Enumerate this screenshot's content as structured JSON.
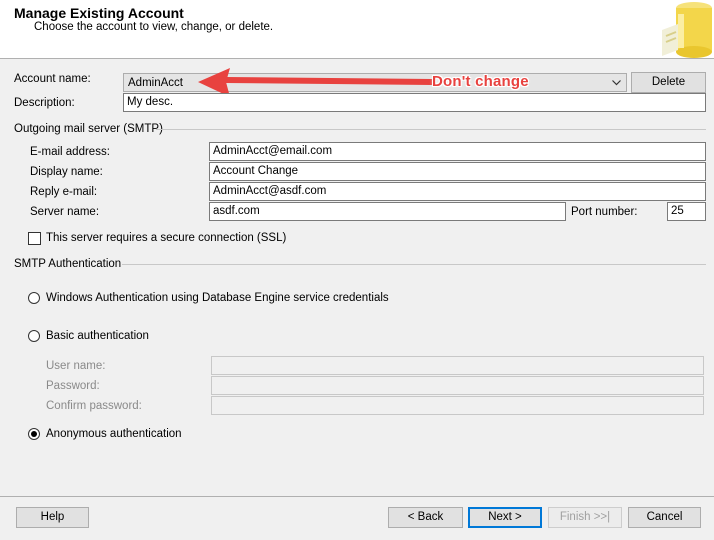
{
  "header": {
    "title": "Manage Existing Account",
    "subtitle": "Choose the account to view, change, or delete."
  },
  "account": {
    "name_label": "Account name:",
    "name_value": "AdminAcct",
    "delete_label": "Delete",
    "description_label": "Description:",
    "description_value": "My desc."
  },
  "annotation": {
    "text": "Don't change",
    "color": "#e8423f"
  },
  "smtp": {
    "section_label": "Outgoing mail server (SMTP)",
    "email_label": "E-mail address:",
    "email_value": "AdminAcct@email.com",
    "display_label": "Display name:",
    "display_value": "Account Change",
    "reply_label": "Reply e-mail:",
    "reply_value": "AdminAcct@asdf.com",
    "server_label": "Server name:",
    "server_value": "asdf.com",
    "port_label": "Port number:",
    "port_value": "25",
    "ssl_label": "This server requires a secure connection (SSL)",
    "ssl_checked": false
  },
  "auth": {
    "section_label": "SMTP Authentication",
    "windows_label": "Windows Authentication using Database Engine service credentials",
    "basic_label": "Basic authentication",
    "username_label": "User name:",
    "password_label": "Password:",
    "confirm_label": "Confirm password:",
    "anonymous_label": "Anonymous authentication",
    "selected": "anonymous"
  },
  "footer": {
    "help": "Help",
    "back": "< Back",
    "next": "Next >",
    "finish": "Finish >>|",
    "cancel": "Cancel"
  }
}
